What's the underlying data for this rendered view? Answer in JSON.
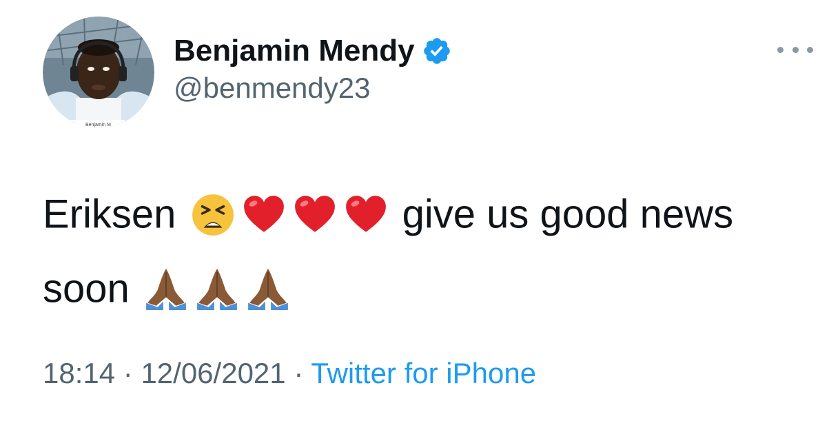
{
  "author": {
    "display_name": "Benjamin Mendy",
    "handle": "@benmendy23",
    "verified": true,
    "avatar_caption": "Benjamin M"
  },
  "tweet": {
    "text_part1": "Eriksen",
    "text_part2": "give us good news",
    "text_part3": "soon",
    "emojis_line1": [
      "tired-face",
      "red-heart",
      "red-heart",
      "red-heart"
    ],
    "emojis_line2": [
      "folded-hands",
      "folded-hands",
      "folded-hands"
    ]
  },
  "meta": {
    "time": "18:14",
    "separator": " · ",
    "date": "12/06/2021",
    "source": "Twitter for iPhone"
  },
  "colors": {
    "text": "#0f1419",
    "secondary": "#536471",
    "link": "#1d9bf0",
    "verified": "#1d9bf0"
  }
}
